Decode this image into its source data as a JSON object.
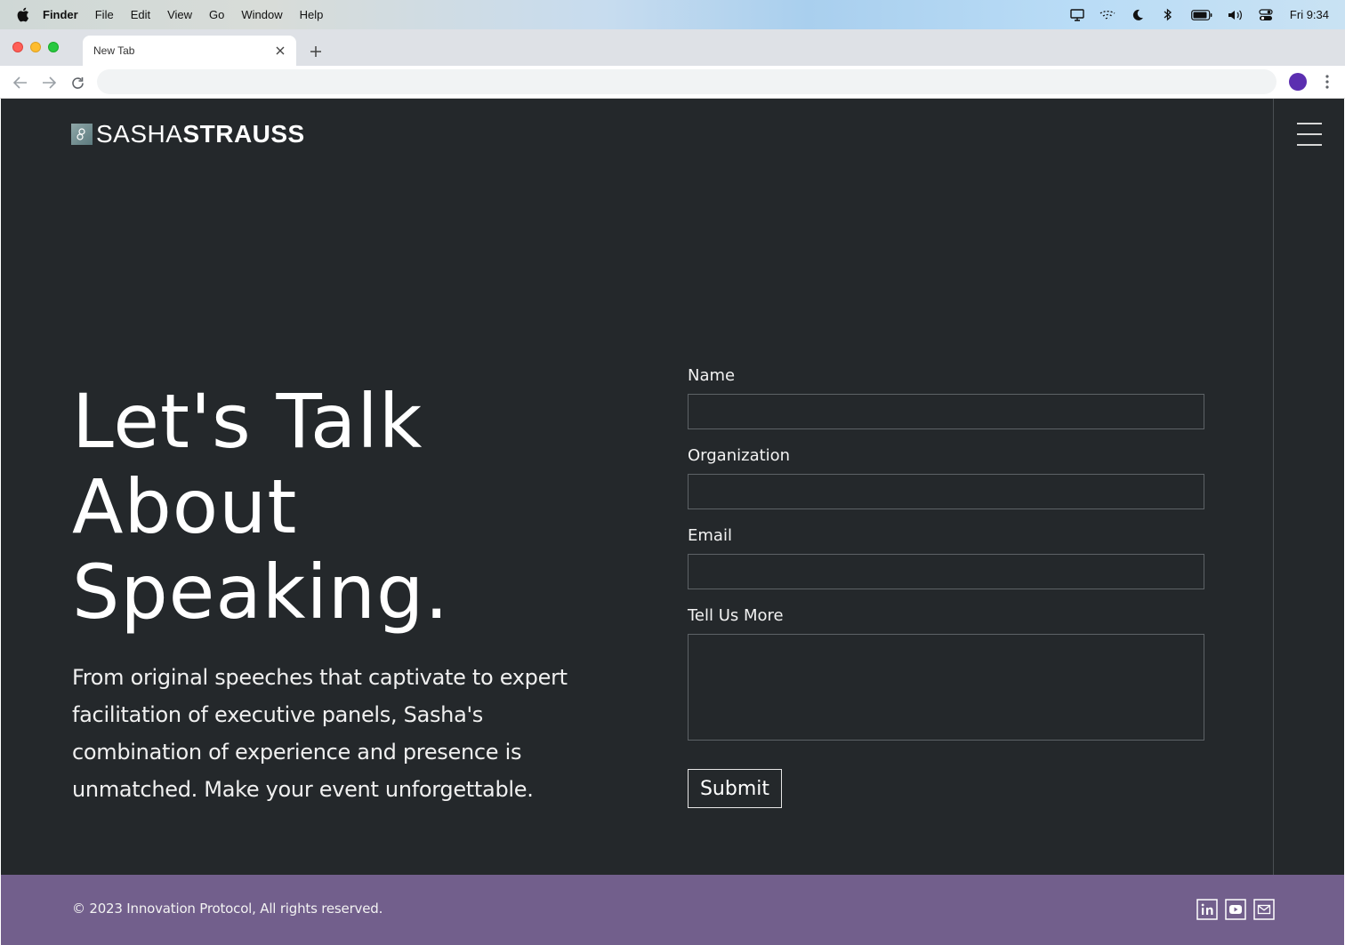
{
  "menubar": {
    "app_name": "Finder",
    "items": [
      "File",
      "Edit",
      "View",
      "Go",
      "Window",
      "Help"
    ],
    "clock": "Fri 9:34",
    "status_icons": [
      "display-icon",
      "wifi-off-icon",
      "moon-icon",
      "bluetooth-icon",
      "battery-icon",
      "volume-icon",
      "control-center-icon"
    ]
  },
  "browser": {
    "tab_title": "New Tab",
    "address_value": "",
    "profile_color": "#5b2eb0"
  },
  "site": {
    "logo_light": "SASHA",
    "logo_bold": "STRAUSS",
    "hero_title_lines": [
      "Let's Talk",
      "About",
      "Speaking."
    ],
    "hero_text": "From original speeches that captivate to expert facilitation of executive panels, Sasha's combination of experience and presence is unmatched. Make your event unforgettable.",
    "form": {
      "name_label": "Name",
      "name_value": "",
      "organization_label": "Organization",
      "organization_value": "",
      "email_label": "Email",
      "email_value": "",
      "message_label": "Tell Us More",
      "message_value": "",
      "submit_label": "Submit"
    },
    "footer": {
      "copyright": "© 2023 Innovation Protocol, All rights reserved.",
      "social_icons": [
        "linkedin-icon",
        "youtube-icon",
        "email-icon"
      ]
    },
    "colors": {
      "background": "#24282b",
      "footer": "#725f8c",
      "text": "#ffffff"
    }
  }
}
